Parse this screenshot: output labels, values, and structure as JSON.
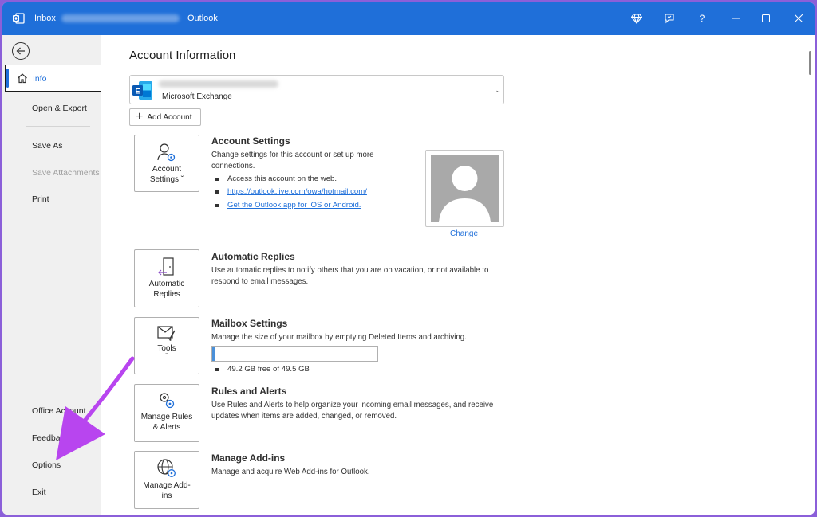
{
  "titlebar": {
    "folder": "Inbox",
    "app": "Outlook",
    "help_glyph": "?",
    "icons": [
      "outlook-app-icon",
      "premium-diamond-icon",
      "feedback-icon",
      "help-icon",
      "minimize-icon",
      "maximize-icon",
      "close-icon"
    ]
  },
  "sidebar": {
    "back_icon": "arrow-left-icon",
    "items": [
      {
        "label": "Info"
      },
      {
        "label": "Open & Export"
      },
      {
        "label": "Save As"
      },
      {
        "label": "Save Attachments"
      },
      {
        "label": "Print"
      },
      {
        "label": "Office Account"
      },
      {
        "label": "Feedback"
      },
      {
        "label": "Options"
      },
      {
        "label": "Exit"
      }
    ]
  },
  "main": {
    "title": "Account Information",
    "account": {
      "type": "Microsoft Exchange"
    },
    "add_account": "Add Account",
    "account_settings": {
      "tile_line1": "Account",
      "tile_line2": "Settings",
      "title": "Account Settings",
      "desc": "Change settings for this account or set up more connections.",
      "bullet1": "Access this account on the web.",
      "url": "https://outlook.live.com/owa/hotmail.com/",
      "app_link": "Get the Outlook app for iOS or Android.",
      "change": "Change"
    },
    "automatic_replies": {
      "tile_line1": "Automatic",
      "tile_line2": "Replies",
      "title": "Automatic Replies",
      "desc": "Use automatic replies to notify others that you are on vacation, or not available to respond to email messages."
    },
    "mailbox": {
      "tile": "Tools",
      "title": "Mailbox Settings",
      "desc": "Manage the size of your mailbox by emptying Deleted Items and archiving.",
      "usage": "49.2 GB free of 49.5 GB",
      "used_fraction": 0.006
    },
    "rules": {
      "tile_line1": "Manage Rules",
      "tile_line2": "& Alerts",
      "title": "Rules and Alerts",
      "desc": "Use Rules and Alerts to help organize your incoming email messages, and receive updates when items are added, changed, or removed."
    },
    "addins": {
      "tile_line1": "Manage Add-",
      "tile_line2": "ins",
      "title": "Manage Add-ins",
      "desc": "Manage and acquire Web Add-ins for Outlook."
    }
  },
  "colors": {
    "titlebar": "#1f6fd9",
    "accent": "#1f6fd9",
    "annotation_arrow": "#b845ef",
    "page_border": "#8b5fd9"
  }
}
